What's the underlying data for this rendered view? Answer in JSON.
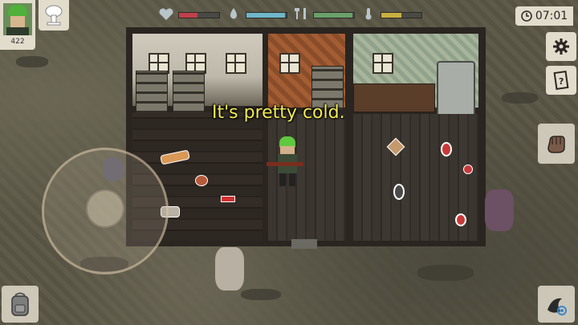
{
  "hud": {
    "player_level": "422",
    "clock_time": "07:01",
    "stats": [
      {
        "name": "health",
        "icon": "heart-icon",
        "fill": 0.45,
        "color": "#c0404a"
      },
      {
        "name": "thirst",
        "icon": "water-drop-icon",
        "fill": 0.95,
        "color": "#6fb6c9"
      },
      {
        "name": "hunger",
        "icon": "fork-knife-icon",
        "fill": 0.95,
        "color": "#6aa06a"
      },
      {
        "name": "temperature",
        "icon": "thermometer-icon",
        "fill": 0.5,
        "color": "#c8b040"
      }
    ]
  },
  "dialogue": {
    "speech": "It's pretty cold."
  },
  "colors": {
    "speech_text": "#f2ea55",
    "hud_panel": "#e2dccd"
  },
  "icons": {
    "settings": "gear-icon",
    "journal": "journal-icon",
    "clock": "clock-icon",
    "backpack": "backpack-icon",
    "skills": "mushroom-cloud-icon",
    "attack": "fist-icon",
    "look": "eye-icon"
  }
}
